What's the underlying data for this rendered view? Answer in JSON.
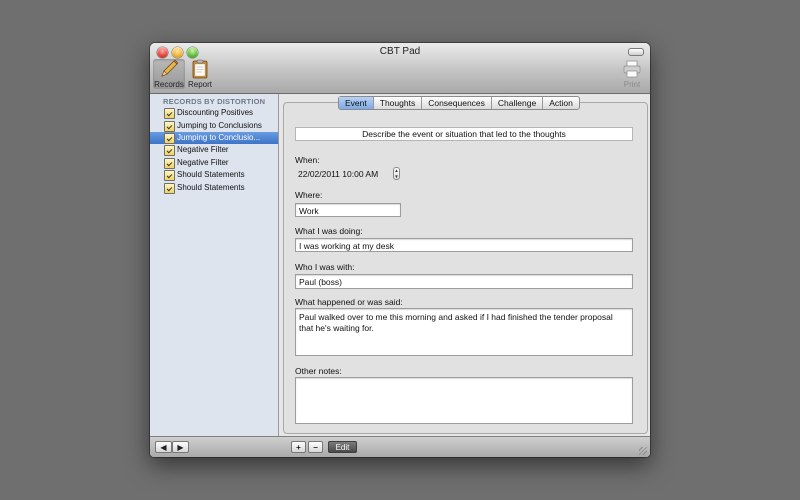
{
  "window": {
    "title": "CBT Pad"
  },
  "toolbar": {
    "records_label": "Records",
    "report_label": "Report",
    "print_label": "Print",
    "records_icon": "pencil-icon",
    "report_icon": "clipboard-icon",
    "print_icon": "printer-icon"
  },
  "sidebar": {
    "header": "RECORDS BY DISTORTION",
    "items": [
      {
        "label": "Discounting Positives",
        "selected": false
      },
      {
        "label": "Jumping to Conclusions",
        "selected": false
      },
      {
        "label": "Jumping to Conclusio...",
        "selected": true
      },
      {
        "label": "Negative Filter",
        "selected": false
      },
      {
        "label": "Negative Filter",
        "selected": false
      },
      {
        "label": "Should Statements",
        "selected": false
      },
      {
        "label": "Should Statements",
        "selected": false
      }
    ]
  },
  "tabs": [
    {
      "label": "Event",
      "selected": true
    },
    {
      "label": "Thoughts",
      "selected": false
    },
    {
      "label": "Consequences",
      "selected": false
    },
    {
      "label": "Challenge",
      "selected": false
    },
    {
      "label": "Action",
      "selected": false
    }
  ],
  "form": {
    "banner": "Describe the event or situation that led to the thoughts",
    "when_label": "When:",
    "when_value": "22/02/2011 10:00 AM",
    "where_label": "Where:",
    "where_value": "Work",
    "doing_label": "What I was doing:",
    "doing_value": "I was working at my desk",
    "with_label": "Who I was with:",
    "with_value": "Paul (boss)",
    "happened_label": "What happened or was said:",
    "happened_value": "Paul walked over to me this morning and asked if I had finished the tender proposal that he's waiting for.",
    "notes_label": "Other notes:",
    "notes_value": ""
  },
  "bottombar": {
    "back_symbol": "◀",
    "forward_symbol": "▶",
    "add_symbol": "+",
    "remove_symbol": "−",
    "edit_label": "Edit"
  },
  "colors": {
    "desktop": "#6f6f6f",
    "selection": "#3d74c8",
    "sidebar_bg": "#dde4ee"
  }
}
